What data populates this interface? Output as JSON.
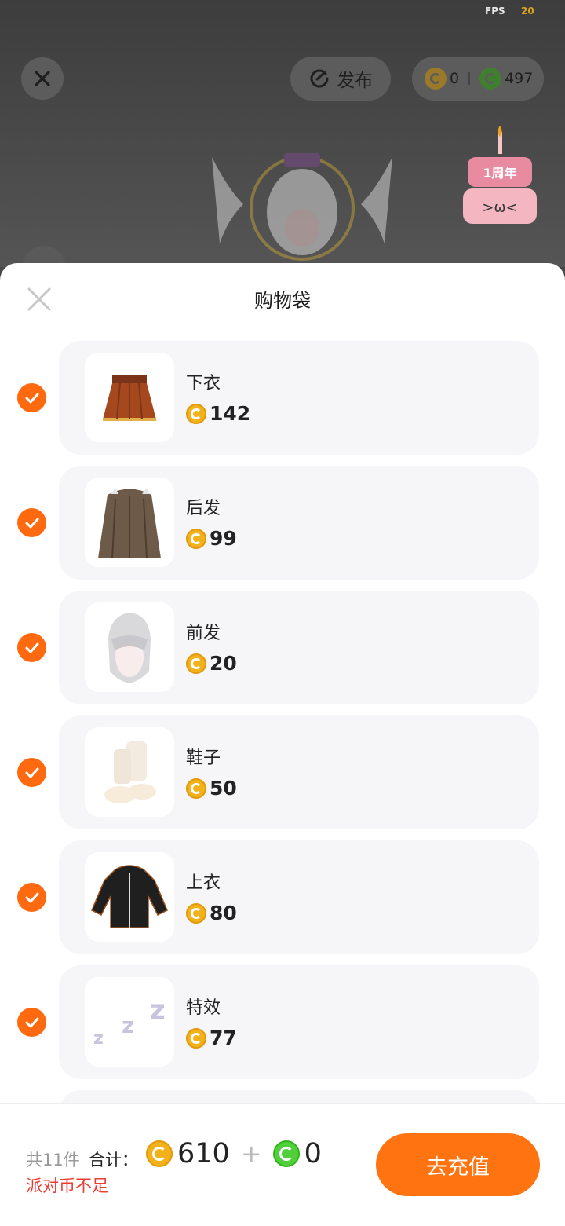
{
  "top": {
    "fps_label": "FPS",
    "fps_value": "20",
    "publish_label": "发布",
    "gold_balance": "0",
    "green_balance": "497",
    "cake_text": "1周年"
  },
  "sheet": {
    "title": "购物袋",
    "items": [
      {
        "name": "下衣",
        "price": "142",
        "icon": "skirt-thumbnail"
      },
      {
        "name": "后发",
        "price": "99",
        "icon": "back-hair-thumbnail"
      },
      {
        "name": "前发",
        "price": "20",
        "icon": "front-hair-thumbnail"
      },
      {
        "name": "鞋子",
        "price": "50",
        "icon": "shoes-thumbnail"
      },
      {
        "name": "上衣",
        "price": "80",
        "icon": "hoodie-thumbnail"
      },
      {
        "name": "特效",
        "price": "77",
        "icon": "zzz-effect-thumbnail"
      }
    ]
  },
  "footer": {
    "count_text": "共11件",
    "total_label": "合计：",
    "gold_total": "610",
    "plus": "+",
    "green_total": "0",
    "warning": "派对币不足",
    "recharge_label": "去充值"
  },
  "colors": {
    "accent": "#ff7410",
    "gold": "#f3b21b",
    "green": "#4fcf3a",
    "warning": "#ee3b30"
  }
}
